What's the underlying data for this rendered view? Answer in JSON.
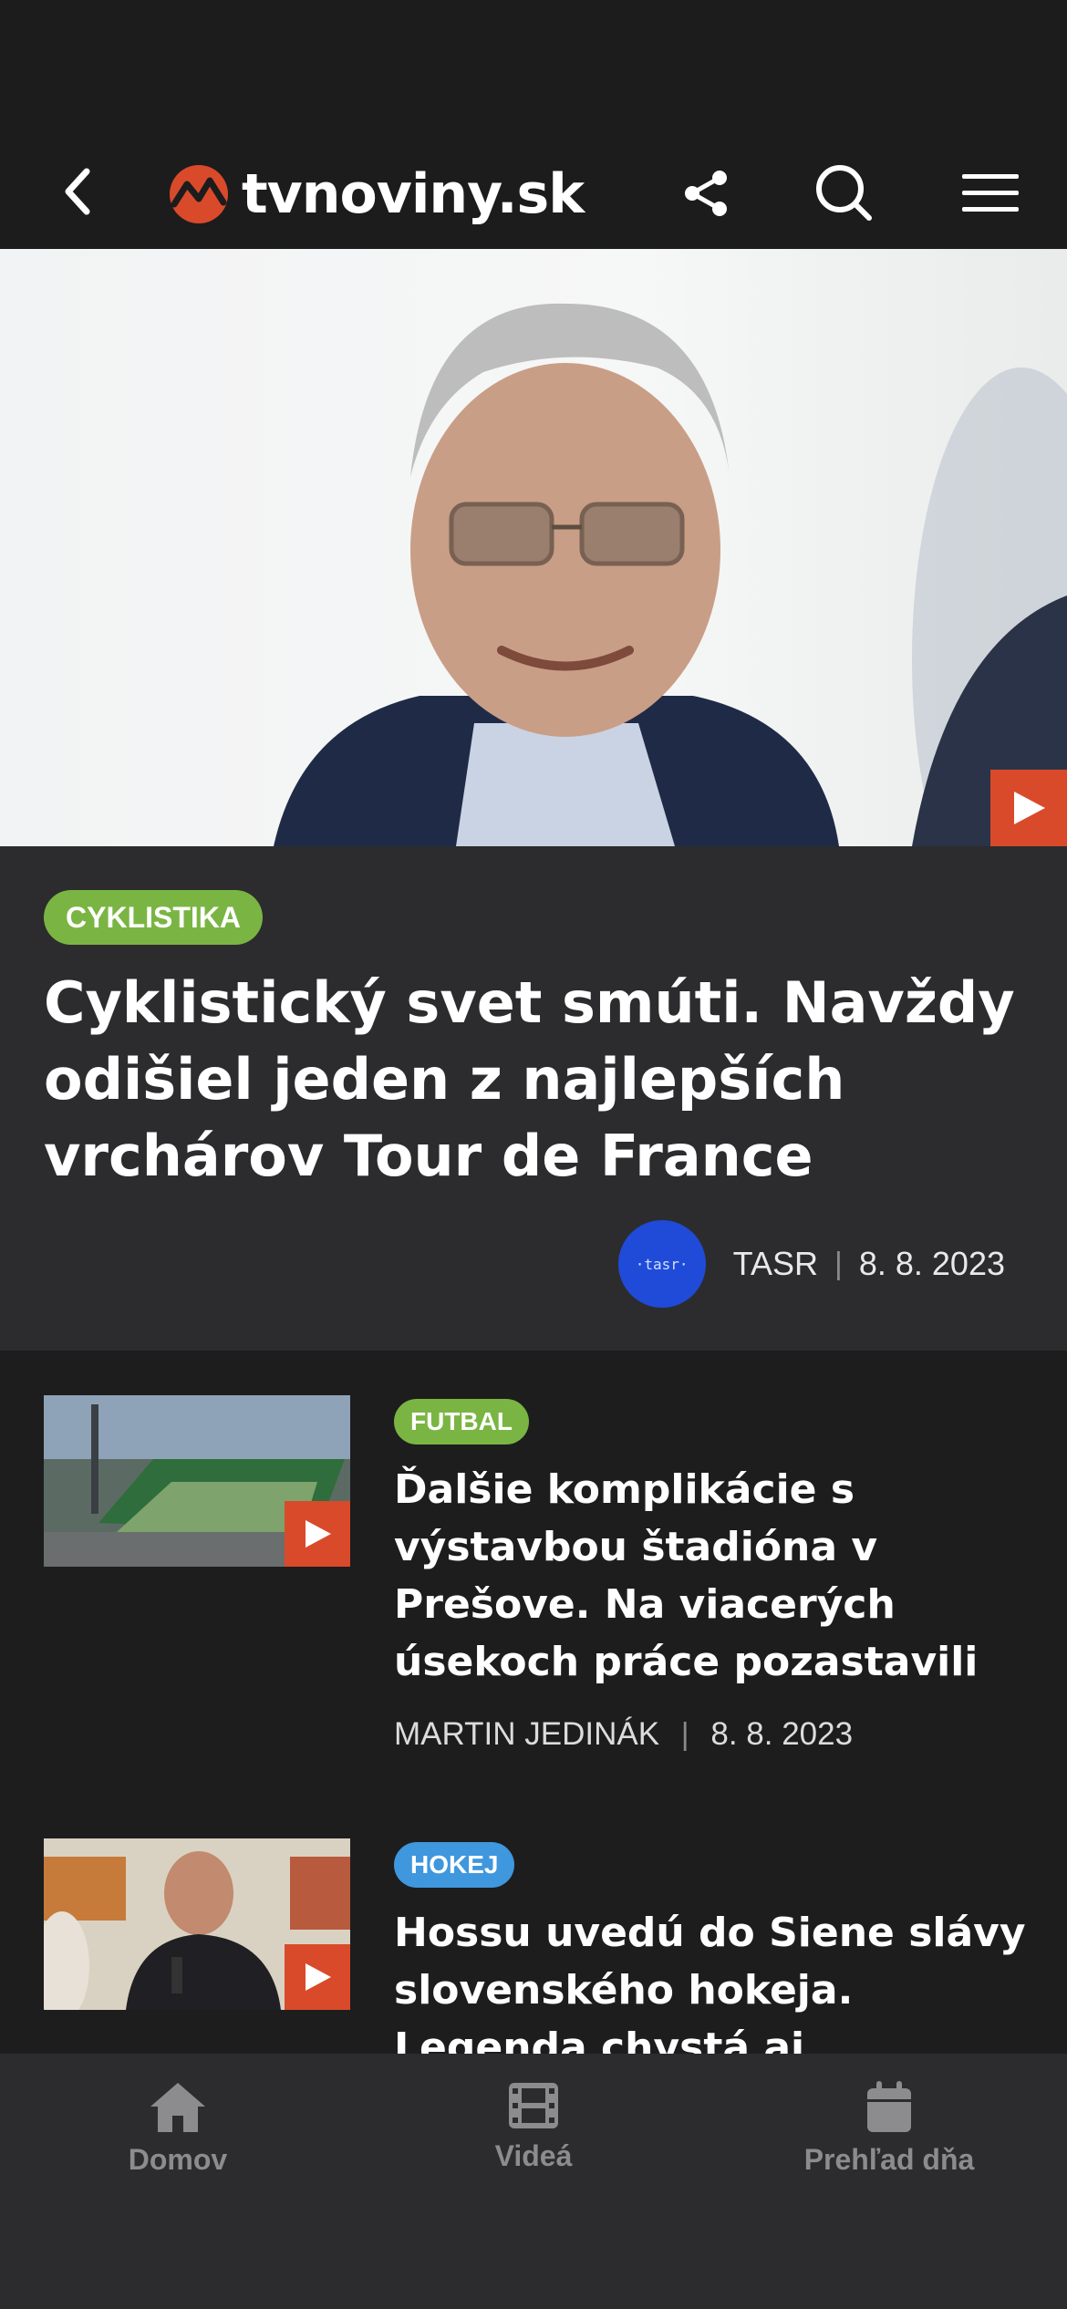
{
  "header": {
    "logo_text": "tvnoviny.sk",
    "icons": [
      "chevron-left-icon",
      "share-icon",
      "search-icon",
      "hamburger-menu-icon"
    ]
  },
  "hero": {
    "category": "CYKLISTIKA",
    "title": "Cyklistický svet smúti. Navždy odišiel jeden z najlepších vrchárov Tour de France",
    "source_avatar_text": "·tasr·",
    "author": "TASR",
    "separator": "|",
    "date": "8. 8. 2023"
  },
  "articles": [
    {
      "category": "FUTBAL",
      "title": "Ďalšie komplikácie s výstavbou štadióna v Prešove. Na viacerých úsekoch práce pozastavili",
      "author": "MARTIN JEDINÁK",
      "separator": "|",
      "date": "8. 8. 2023"
    },
    {
      "category": "HOKEJ",
      "title": "Hossu uvedú do Siene slávy slovenského hokeja. Legenda chystá aj rozlúčkový zápas"
    }
  ],
  "bottom_nav": {
    "items": [
      {
        "label": "Domov",
        "icon": "home-icon"
      },
      {
        "label": "Videá",
        "icon": "film-icon"
      },
      {
        "label": "Prehľad dňa",
        "icon": "calendar-icon"
      }
    ]
  },
  "colors": {
    "accent": "#d94a2b",
    "tag_green": "#7ab543",
    "tag_blue": "#3f97de",
    "background": "#1d1d1e",
    "card": "#2c2c2e"
  }
}
